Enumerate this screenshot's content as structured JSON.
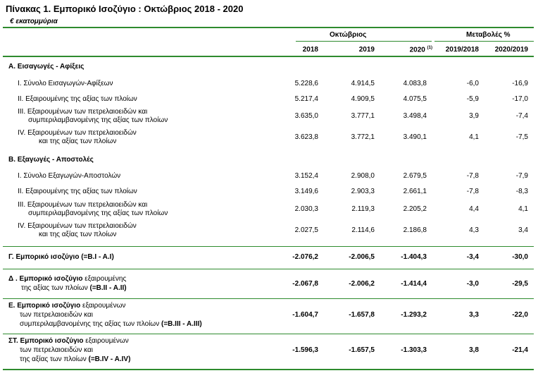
{
  "title": "Πίνακας 1. Εμπορικό Ισοζύγιο :  Οκτώβριος 2018  - 2020",
  "unit": "€ εκατομμύρια",
  "header": {
    "group_month": "Οκτώβριος",
    "group_change": "Μεταβολές %",
    "col_2018": "2018",
    "col_2019": "2019",
    "col_2020": "2020",
    "col_2020_note": "(1)",
    "col_ch1": "2019/2018",
    "col_ch2": "2020/2019"
  },
  "section_a": "A. Εισαγωγές - Αφίξεις",
  "section_b": "B. Εξαγωγές - Αποστολές",
  "rows_a": [
    {
      "l1": "I.  Σύνολο Εισαγωγών-Αφίξεων",
      "l2": "",
      "v": [
        "5.228,6",
        "4.914,5",
        "4.083,8",
        "-6,0",
        "-16,9"
      ]
    },
    {
      "l1": "II.  Εξαιρουμένης  της αξίας των πλοίων",
      "l2": "",
      "v": [
        "5.217,4",
        "4.909,5",
        "4.075,5",
        "-5,9",
        "-17,0"
      ]
    },
    {
      "l1": "III.  Εξαιρουμένων των πετρελαιοειδών και",
      "l2": "συμπεριλαμβανομένης της αξίας των πλοίων",
      "v": [
        "3.635,0",
        "3.777,1",
        "3.498,4",
        "3,9",
        "-7,4"
      ]
    },
    {
      "l1": "IV.  Εξαιρουμένων των πετρελαιοειδών",
      "l2": "και της αξίας των πλοίων",
      "v": [
        "3.623,8",
        "3.772,1",
        "3.490,1",
        "4,1",
        "-7,5"
      ]
    }
  ],
  "rows_b": [
    {
      "l1": "I.  Σύνολο Εξαγωγών-Αποστολών",
      "l2": "",
      "v": [
        "3.152,4",
        "2.908,0",
        "2.679,5",
        "-7,8",
        "-7,9"
      ]
    },
    {
      "l1": "II.  Εξαιρουμένης  της αξίας των πλοίων",
      "l2": "",
      "v": [
        "3.149,6",
        "2.903,3",
        "2.661,1",
        "-7,8",
        "-8,3"
      ]
    },
    {
      "l1": "III.  Εξαιρουμένων των πετρελαιοειδών και",
      "l2": "συμπεριλαμβανομένης της αξίας των πλοίων",
      "v": [
        "2.030,3",
        "2.119,3",
        "2.205,2",
        "4,4",
        "4,1"
      ]
    },
    {
      "l1": "IV.  Εξαιρουμένων των πετρελαιοειδών",
      "l2": "και της αξίας των πλοίων",
      "v": [
        "2.027,5",
        "2.114,6",
        "2.186,8",
        "4,3",
        "3,4"
      ]
    }
  ],
  "balance_g": {
    "l1": "Γ. Εμπορικό ισοζύγιο (=B.I - A.I)",
    "v": [
      "-2.076,2",
      "-2.006,5",
      "-1.404,3",
      "-3,4",
      "-30,0"
    ]
  },
  "balance_d": {
    "l1a": "Δ . Εμπορικό ισοζύγιο",
    "l1b": " εξαιρουμένης",
    "l2a": "της αξίας των πλοίων ",
    "l2b": "(=B.II - A.II)",
    "v": [
      "-2.067,8",
      "-2.006,2",
      "-1.414,4",
      "-3,0",
      "-29,5"
    ]
  },
  "balance_e": {
    "l1a": "E. Εμπορικό ισοζύγιο",
    "l1b": " εξαιρουμένων",
    "l2": "των πετρελαιοειδών και",
    "l3a": "συμπεριλαμβανομένης της αξίας των πλοίων ",
    "l3b": "(=B.III - A.III)",
    "v": [
      "-1.604,7",
      "-1.657,8",
      "-1.293,2",
      "3,3",
      "-22,0"
    ]
  },
  "balance_st": {
    "l1a": "ΣT. Εμπορικό ισοζύγιο",
    "l1b": " εξαιρουμένων",
    "l2": "των πετρελαιοειδών και",
    "l3a": "της αξίας των πλοίων ",
    "l3b": "(=B.IV - A.IV)",
    "v": [
      "-1.596,3",
      "-1.657,5",
      "-1.303,3",
      "3,8",
      "-21,4"
    ]
  }
}
